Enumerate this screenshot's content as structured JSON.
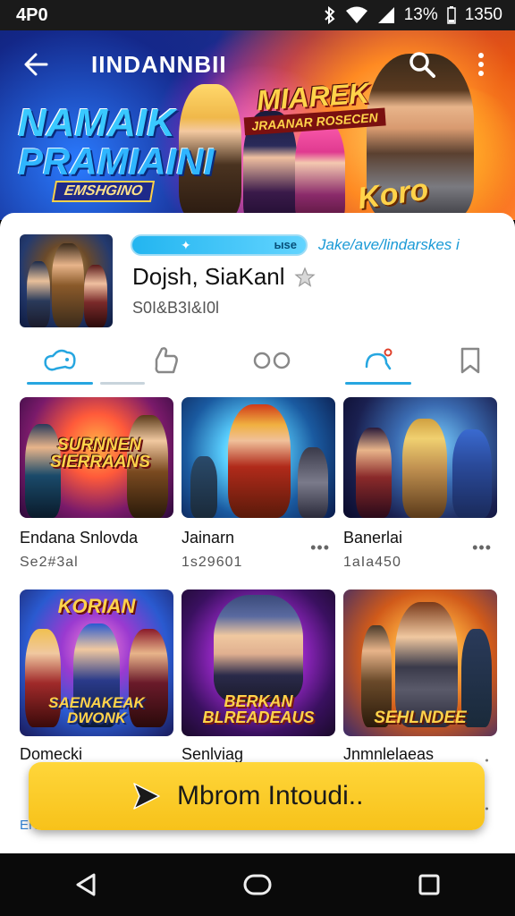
{
  "status_bar": {
    "time_left": "4P0",
    "battery": "13%",
    "clock": "1350"
  },
  "app_bar": {
    "title": "IINDANNBII"
  },
  "hero": {
    "logo_line1": "NAMAIK",
    "logo_line2": "PRAMIAINI",
    "logo_line3": "EMSHGINO",
    "badge_line1": "MIAREK",
    "badge_line2": "JRAANAR ROSECEN",
    "stamp": "Koro"
  },
  "app": {
    "progress_label": "ыse",
    "store_link": "Jake/ave/lindarskes",
    "name": "Dojsh, SiaKanl",
    "meta": "S0I&B3I&I0l"
  },
  "tabs": [
    {
      "icon": "controller-icon",
      "active": true
    },
    {
      "icon": "thumb-up-icon",
      "active": false
    },
    {
      "icon": "infinity-icon",
      "active": false
    },
    {
      "icon": "notification-icon",
      "active": true
    },
    {
      "icon": "bookmark-icon",
      "active": false
    }
  ],
  "cards": [
    {
      "title": "Endana Snlovda",
      "sub": "Se2#3al",
      "thumb_title": "SURNNEN SIERRAANS"
    },
    {
      "title": "Jainarn",
      "sub": "1s29601",
      "thumb_title": ""
    },
    {
      "title": "Banerlai",
      "sub": "1aIa450",
      "thumb_title": ""
    }
  ],
  "cards_row2": [
    {
      "title": "Domecki",
      "thumb_title_top": "KORIAN",
      "thumb_title_bottom": "SAENAKEAK DWONK"
    },
    {
      "title": "Senlviag",
      "thumb_title_bottom": "BERKAN BLREADEAUS"
    },
    {
      "title": "Jnmnlelaeas",
      "thumb_title_bottom": "SEHLNDEE"
    }
  ],
  "peek_text": "ENJNNERENS",
  "cta": {
    "label": "Mbrom Intoudi.."
  },
  "colors": {
    "accent": "#26a6e0",
    "cta": "#f7c21a"
  }
}
